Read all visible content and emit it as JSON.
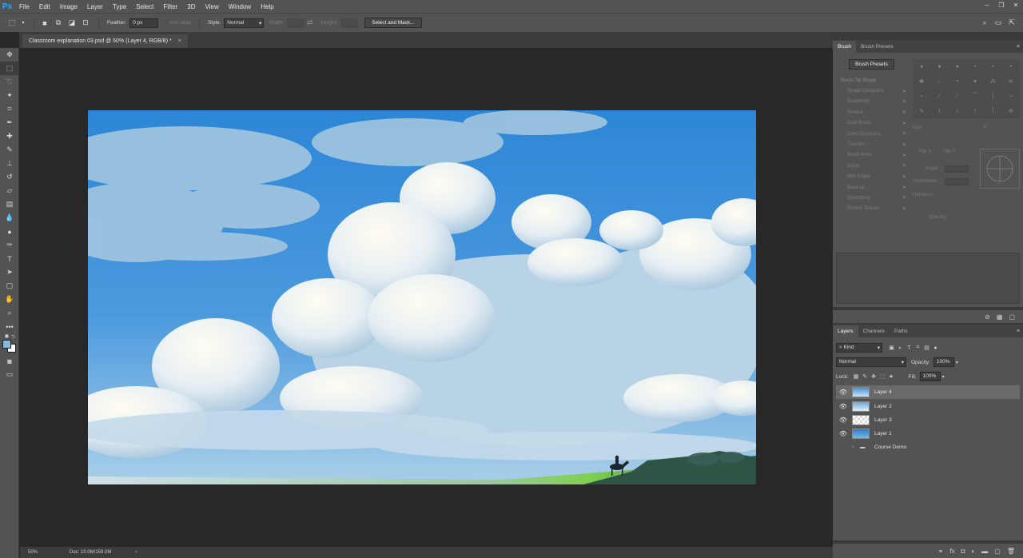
{
  "app": {
    "logo": "Ps"
  },
  "menu": [
    "File",
    "Edit",
    "Image",
    "Layer",
    "Type",
    "Select",
    "Filter",
    "3D",
    "View",
    "Window",
    "Help"
  ],
  "options": {
    "feather_label": "Feather:",
    "feather_value": "0 px",
    "anti_alias": "Anti-alias",
    "style_label": "Style:",
    "style_value": "Normal",
    "width_label": "Width:",
    "height_label": "Height:",
    "select_mask_button": "Select and Mask..."
  },
  "document": {
    "tab_title": "Classroom explanation 03.psd @ 50% (Layer 4, RGB/8) *",
    "close": "×"
  },
  "status": {
    "zoom": "50%",
    "doc_size": "Doc: 10.0M/159.0M",
    "arrow": "›"
  },
  "brush_panel": {
    "tabs": [
      "Brush",
      "Brush Presets"
    ],
    "presets_button": "Brush Presets",
    "list": [
      "Brush Tip Shape",
      "Shape Dynamics",
      "Scattering",
      "Texture",
      "Dual Brush",
      "Color Dynamics",
      "Transfer",
      "Brush Pose",
      "Noise",
      "Wet Edges",
      "Build-up",
      "Smoothing",
      "Protect Texture"
    ],
    "size_label": "Size",
    "flip_x": "Flip X",
    "flip_y": "Flip Y",
    "angle_label": "Angle:",
    "roundness_label": "Roundness:",
    "hardness_label": "Hardness",
    "spacing_label": "Spacing"
  },
  "layers_panel": {
    "tabs": [
      "Layers",
      "Channels",
      "Paths"
    ],
    "filter_kind": "Kind",
    "blend_mode": "Normal",
    "opacity_label": "Opacity:",
    "opacity_value": "100%",
    "lock_label": "Lock:",
    "fill_label": "Fill:",
    "fill_value": "100%",
    "layers": [
      {
        "name": "Layer 4",
        "selected": true
      },
      {
        "name": "Layer 2",
        "selected": false
      },
      {
        "name": "Layer 3",
        "selected": false
      },
      {
        "name": "Layer 1",
        "selected": false
      }
    ],
    "group": "Course Demo"
  },
  "colors": {
    "foreground": "#8bb8d9",
    "background": "#ffffff",
    "accent": "#31a8ff"
  }
}
